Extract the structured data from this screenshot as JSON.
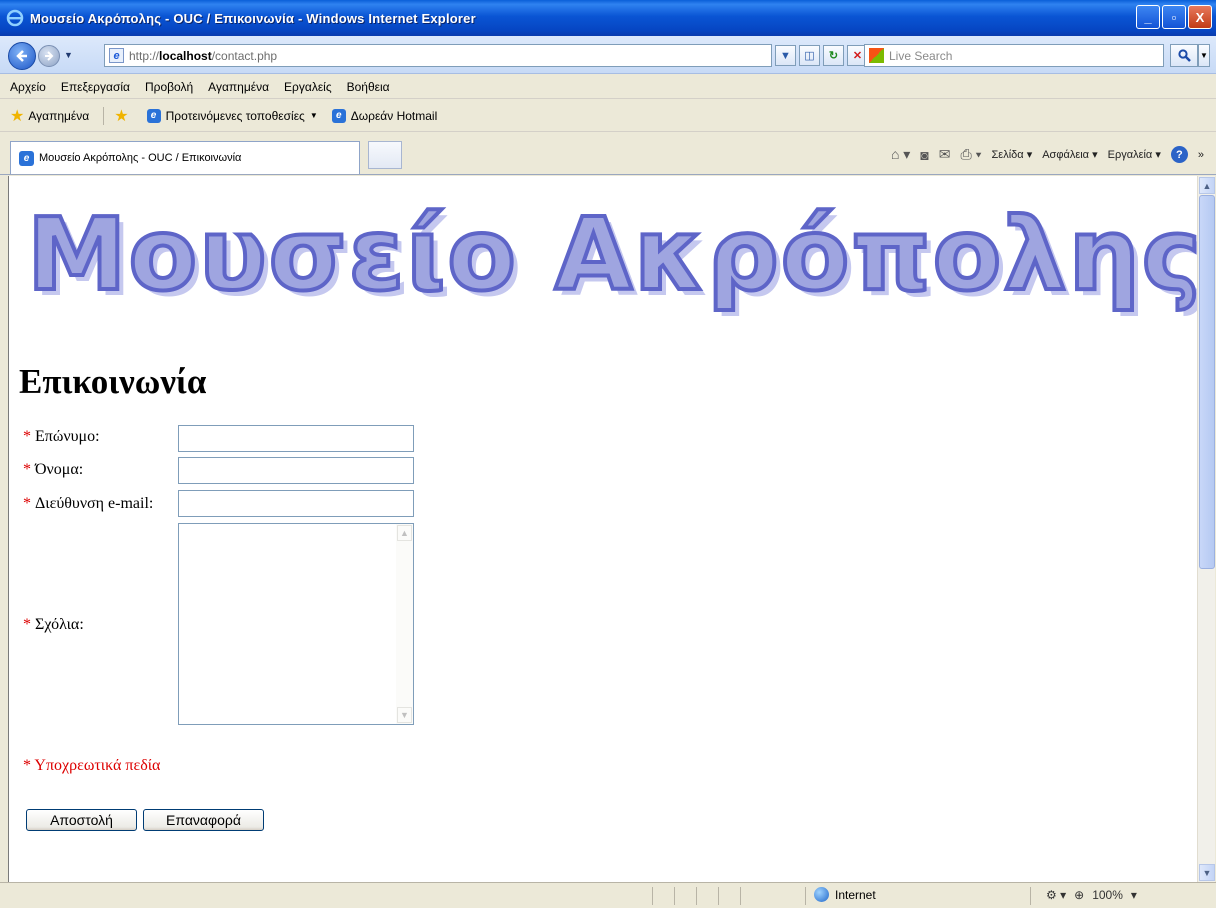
{
  "window": {
    "title": "Μουσείο Ακρόπολης - OUC / Επικοινωνία - Windows Internet Explorer",
    "minimize": "_",
    "maximize": "▫",
    "close": "X"
  },
  "address_bar": {
    "prefix": "http://",
    "host": "localhost",
    "path": "/contact.php",
    "search_placeholder": "Live Search"
  },
  "menu": [
    "Αρχείο",
    "Επεξεργασία",
    "Προβολή",
    "Αγαπημένα",
    "Εργαλείς",
    "Βοήθεια"
  ],
  "favorites_bar": {
    "favorites_label": "Αγαπημένα",
    "suggested_sites": "Προτεινόμενες τοποθεσίες",
    "hotmail": "Δωρεάν Hotmail"
  },
  "tab": {
    "title": "Μουσείο Ακρόπολης - OUC / Επικοινωνία"
  },
  "command_bar": {
    "page": "Σελίδα",
    "safety": "Ασφάλεια",
    "tools": "Εργαλεία"
  },
  "page": {
    "logo_text": "Μουσείο Ακρόπολης - OUC",
    "heading": "Επικοινωνία",
    "required_mark": "*",
    "fields": {
      "surname_label": "Επώνυμο:",
      "name_label": "Όνομα:",
      "email_label": "Διεύθυνση e-mail:",
      "comments_label": "Σχόλια:"
    },
    "required_note": "* Υποχρεωτικά πεδία",
    "submit_label": "Αποστολή",
    "reset_label": "Επαναφορά"
  },
  "status_bar": {
    "zone": "Internet",
    "zoom": "100%"
  }
}
